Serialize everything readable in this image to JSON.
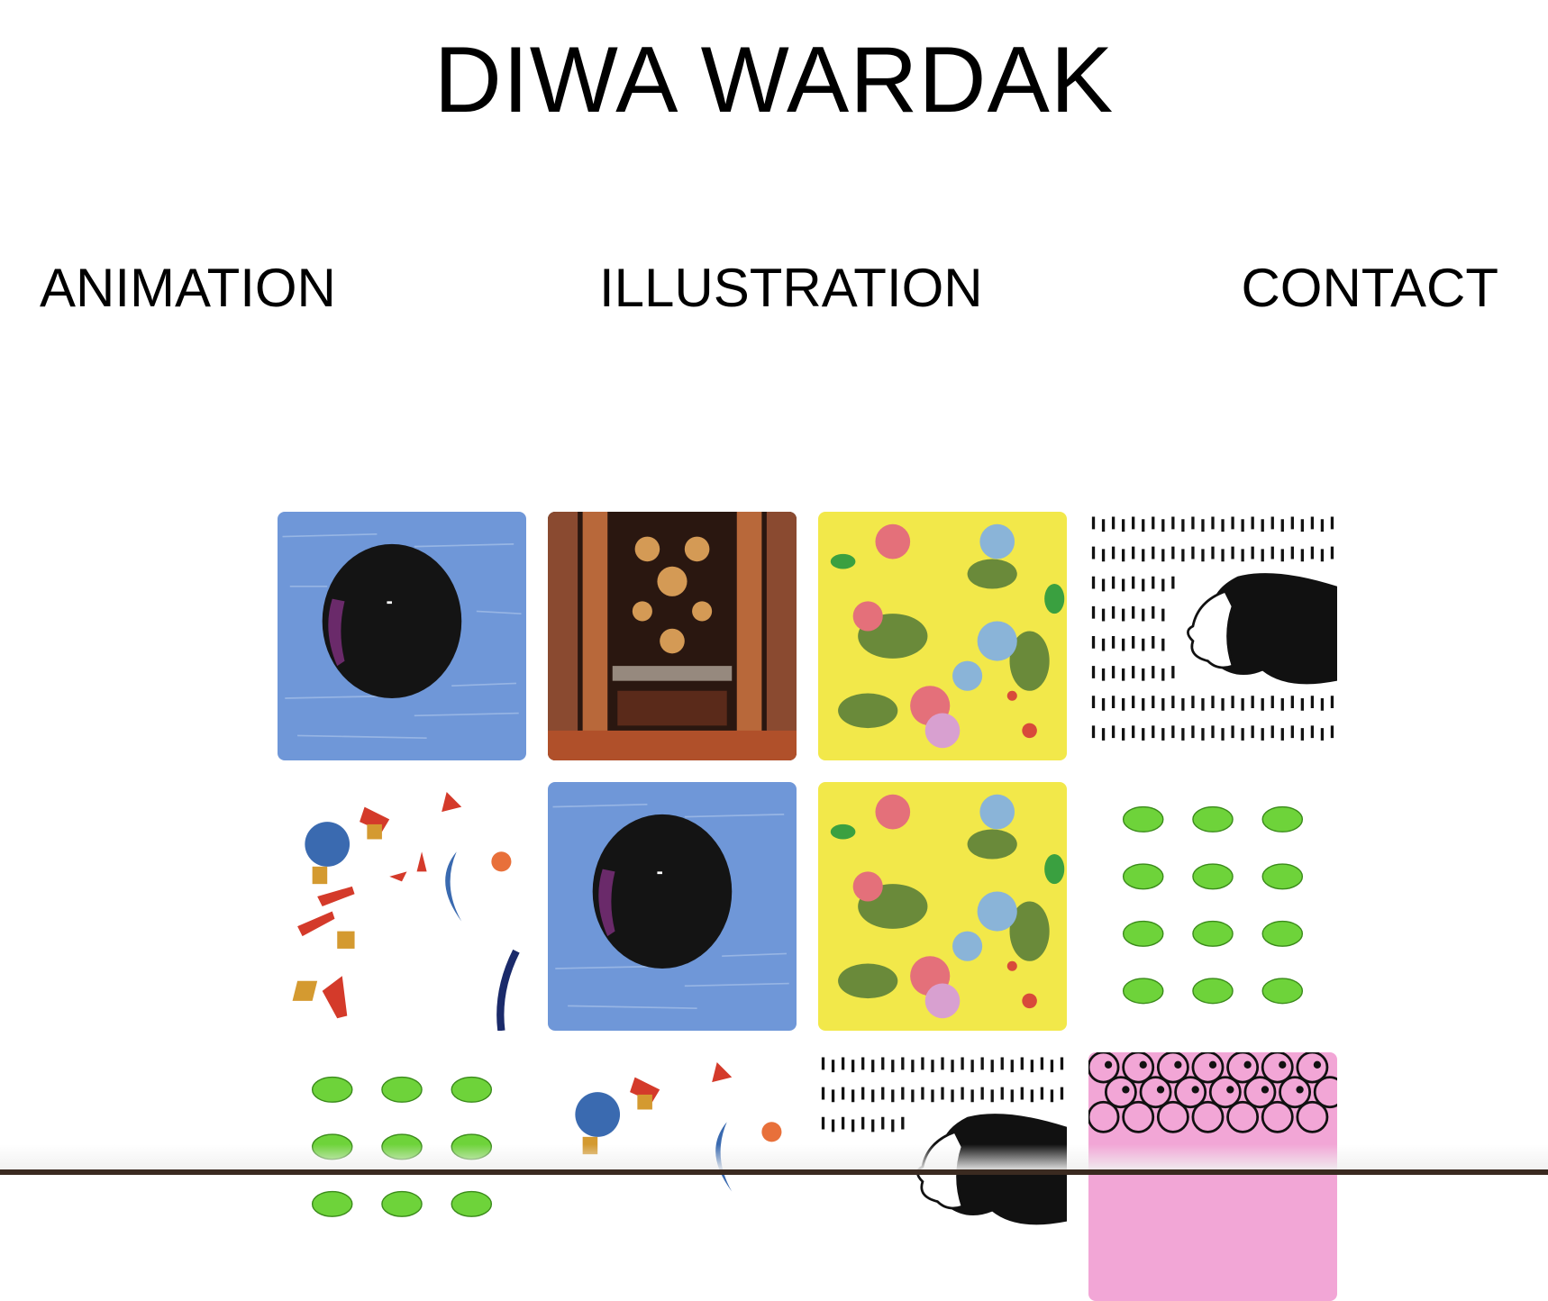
{
  "site": {
    "title": "DIWA WARDAK"
  },
  "nav": {
    "animation": "ANIMATION",
    "illustration": "ILLUSTRATION",
    "contact": "CONTACT"
  },
  "gallery": {
    "tiles": [
      {
        "artwork": "blue-moon"
      },
      {
        "artwork": "ornate-textile"
      },
      {
        "artwork": "yellow-floral"
      },
      {
        "artwork": "profile-dashes"
      },
      {
        "artwork": "paper-collage"
      },
      {
        "artwork": "blue-moon"
      },
      {
        "artwork": "yellow-floral"
      },
      {
        "artwork": "frog-grid"
      },
      {
        "artwork": "frog-grid"
      },
      {
        "artwork": "paper-collage"
      },
      {
        "artwork": "profile-dashes"
      },
      {
        "artwork": "pink-scales"
      }
    ]
  },
  "colors": {
    "background": "#ffffff",
    "text": "#000000",
    "sky_blue": "#6f97d8",
    "floral_yellow": "#f2e84a",
    "frog_green": "#6ed33a",
    "pink": "#f2a6d6"
  }
}
